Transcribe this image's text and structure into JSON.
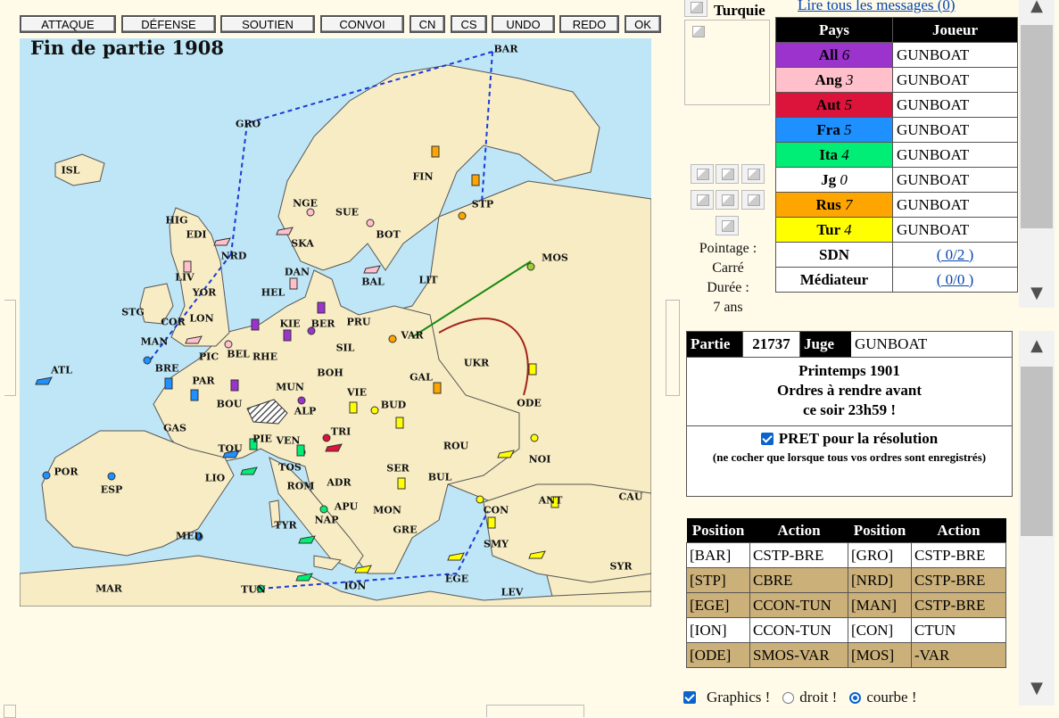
{
  "toolbar": {
    "buttons": [
      "ATTAQUE",
      "DÉFENSE",
      "SOUTIEN",
      "CONVOI",
      "CN",
      "CS",
      "UNDO",
      "REDO",
      "OK"
    ]
  },
  "map": {
    "title": "Fin de partie 1908",
    "provinces": [
      "BAR",
      "GRO",
      "ISL",
      "FIN",
      "STP",
      "NGE",
      "SUE",
      "HIG",
      "EDI",
      "NRD",
      "SKA",
      "BOT",
      "MOS",
      "DAN",
      "LIV",
      "YOR",
      "BAL",
      "LIT",
      "STG",
      "HEL",
      "COR",
      "LON",
      "KIE",
      "BER",
      "PRU",
      "MAN",
      "VAR",
      "PIC",
      "BEL",
      "RHE",
      "SIL",
      "ATL",
      "BRE",
      "UKR",
      "PAR",
      "BOH",
      "MUN",
      "GAL",
      "VIE",
      "BOU",
      "ALP",
      "BUD",
      "ODE",
      "GAS",
      "TRI",
      "TOU",
      "PIE",
      "VEN",
      "ROU",
      "NOI",
      "POR",
      "LIO",
      "TOS",
      "SER",
      "BUL",
      "ESP",
      "ROM",
      "ADR",
      "APU",
      "MON",
      "CON",
      "ANT",
      "CAU",
      "NAP",
      "MED",
      "TYR",
      "SMY",
      "GRE",
      "SYR",
      "MAR",
      "ION",
      "EGE",
      "TUN",
      "LEV"
    ]
  },
  "side": {
    "country_label": "Turquie",
    "pointage_label": "Pointage :",
    "pointage_value": "Carré",
    "duree_label": "Durée :",
    "duree_value": "7 ans"
  },
  "messages_link": "Lire tous les messages (0)",
  "players": {
    "headers": [
      "Pays",
      "Joueur"
    ],
    "rows": [
      {
        "pays": "All",
        "count": "6",
        "joueur": "GUNBOAT",
        "color": "#9b33cc"
      },
      {
        "pays": "Ang",
        "count": "3",
        "joueur": "GUNBOAT",
        "color": "#ffc0cb"
      },
      {
        "pays": "Aut",
        "count": "5",
        "joueur": "GUNBOAT",
        "color": "#dc143c"
      },
      {
        "pays": "Fra",
        "count": "5",
        "joueur": "GUNBOAT",
        "color": "#1e90ff"
      },
      {
        "pays": "Ita",
        "count": "4",
        "joueur": "GUNBOAT",
        "color": "#00ee76"
      },
      {
        "pays": "Jg",
        "count": "0",
        "joueur": "GUNBOAT",
        "color": "#ffffff"
      },
      {
        "pays": "Rus",
        "count": "7",
        "joueur": "GUNBOAT",
        "color": "#ffa500"
      },
      {
        "pays": "Tur",
        "count": "4",
        "joueur": "GUNBOAT",
        "color": "#ffff00"
      }
    ],
    "sdn": {
      "label": "SDN",
      "link": "( 0/2 )"
    },
    "mediateur": {
      "label": "Médiateur",
      "link": "( 0/0 )"
    }
  },
  "partie": {
    "label": "Partie",
    "number": "21737",
    "juge_label": "Juge",
    "juge": "GUNBOAT",
    "phase_lines": [
      "Printemps 1901",
      "Ordres à rendre avant",
      "ce soir 23h59 !"
    ],
    "pret_label": "PRET pour la résolution",
    "pret_note": "(ne cocher que lorsque tous vos ordres sont enregistrés)"
  },
  "orders": {
    "headers": [
      "Position",
      "Action",
      "Position",
      "Action"
    ],
    "rows": [
      [
        "[BAR]",
        "CSTP-BRE",
        "[GRO]",
        "CSTP-BRE"
      ],
      [
        "[STP]",
        "CBRE",
        "[NRD]",
        "CSTP-BRE"
      ],
      [
        "[EGE]",
        "CCON-TUN",
        "[MAN]",
        "CSTP-BRE"
      ],
      [
        "[ION]",
        "CCON-TUN",
        "[CON]",
        "CTUN"
      ],
      [
        "[ODE]",
        "SMOS-VAR",
        "[MOS]",
        "-VAR"
      ]
    ]
  },
  "graphics": {
    "label": "Graphics !",
    "opt1": "droit !",
    "opt2": "courbe !"
  }
}
